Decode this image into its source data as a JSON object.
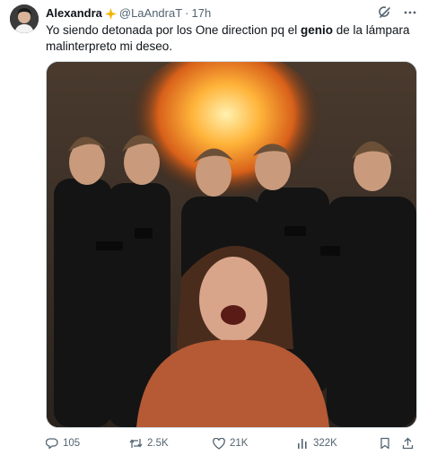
{
  "author": {
    "name": "Alexandra",
    "badge_icon": "sparkles-icon",
    "handle": "@LaAndraT",
    "separator": "·",
    "time": "17h"
  },
  "tweet": {
    "text_part1": "Yo siendo detonada por los One direction pq el ",
    "text_bold": "genio",
    "text_part2": " de la lámpara malinterpreto mi deseo."
  },
  "icons": {
    "grok": "grok-icon",
    "more": "more-icon"
  },
  "actions": {
    "replies": "105",
    "reposts": "2.5K",
    "likes": "21K",
    "views": "322K"
  },
  "colors": {
    "text": "#0f1419",
    "muted": "#536471",
    "badge": "#f4b400",
    "border": "#cfd9de"
  }
}
